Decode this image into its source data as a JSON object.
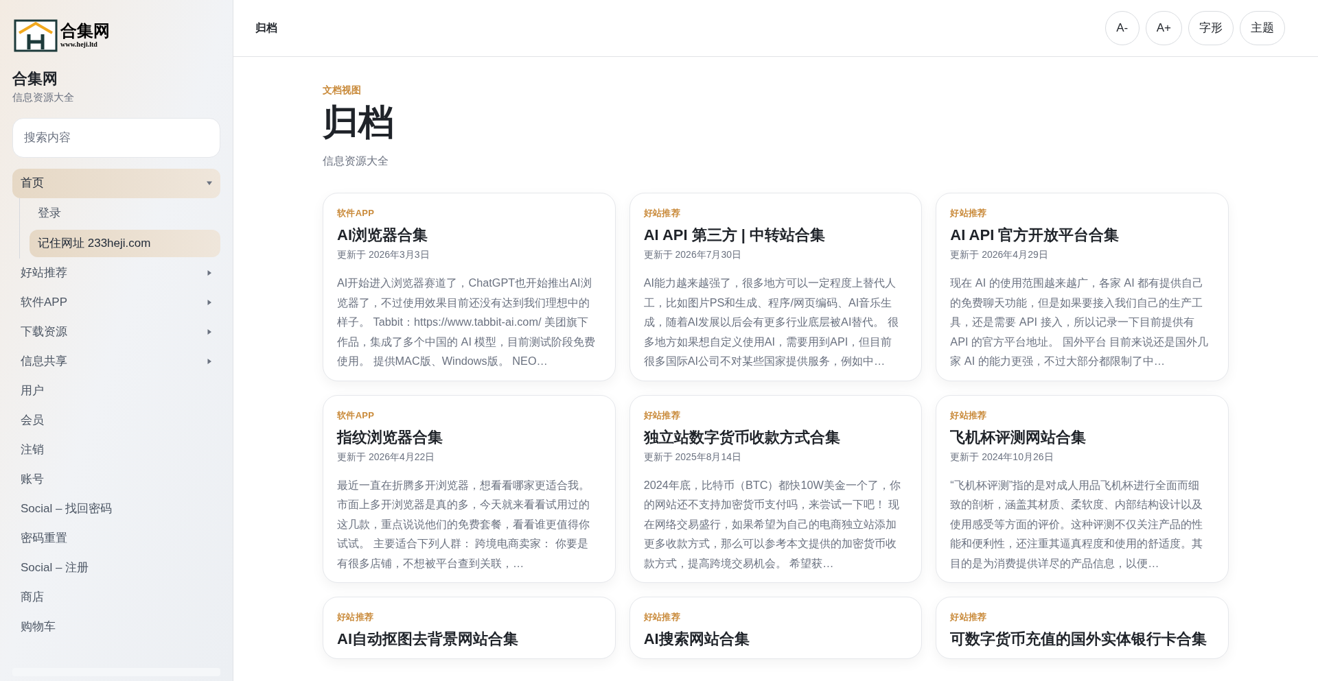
{
  "sidebar": {
    "logo": {
      "mark_text": "合集网",
      "url": "www.heji.ltd"
    },
    "site_name": "合集网",
    "tagline": "信息资源大全",
    "search": {
      "placeholder": "搜索内容"
    },
    "nav": [
      {
        "label": "首页",
        "selected": true,
        "expanded": true,
        "children": [
          {
            "label": "登录",
            "selected": false
          },
          {
            "label": "记住网址 233heji.com",
            "selected": true
          }
        ]
      },
      {
        "label": "好站推荐",
        "selected": false,
        "expanded": false
      },
      {
        "label": "软件APP",
        "selected": false,
        "expanded": false
      },
      {
        "label": "下载资源",
        "selected": false,
        "expanded": false
      },
      {
        "label": "信息共享",
        "selected": false,
        "expanded": false
      },
      {
        "label": "用户",
        "selected": false
      },
      {
        "label": "会员",
        "selected": false
      },
      {
        "label": "注销",
        "selected": false
      },
      {
        "label": "账号",
        "selected": false
      },
      {
        "label": "Social – 找回密码",
        "selected": false
      },
      {
        "label": "密码重置",
        "selected": false
      },
      {
        "label": "Social – 注册",
        "selected": false
      },
      {
        "label": "商店",
        "selected": false
      },
      {
        "label": "购物车",
        "selected": false
      }
    ]
  },
  "header": {
    "breadcrumb": "归档",
    "buttons": [
      "A-",
      "A+",
      "字形",
      "主题"
    ]
  },
  "page": {
    "eyebrow": "文档视图",
    "title": "归档",
    "subtitle": "信息资源大全"
  },
  "cards": [
    {
      "category": "软件APP",
      "title": "AI浏览器合集",
      "date": "更新于 2026年3月3日",
      "excerpt": "AI开始进入浏览器赛道了，ChatGPT也开始推出AI浏览器了，不过使用效果目前还没有达到我们理想中的样子。 Tabbit：https://www.tabbit-ai.com/ 美团旗下作品，集成了多个中国的 AI 模型，目前测试阶段免费使用。 提供MAC版、Windows版。 NEO…"
    },
    {
      "category": "好站推荐",
      "title": "AI API 第三方 | 中转站合集",
      "date": "更新于 2026年7月30日",
      "excerpt": "AI能力越来越强了，很多地方可以一定程度上替代人工，比如图片PS和生成、程序/网页编码、AI音乐生成，随着AI发展以后会有更多行业底层被AI替代。 很多地方如果想自定义使用AI，需要用到API，但目前很多国际AI公司不对某些国家提供服务，例如中…"
    },
    {
      "category": "好站推荐",
      "title": "AI API 官方开放平台合集",
      "date": "更新于 2026年4月29日",
      "excerpt": "现在 AI 的使用范围越来越广，各家 AI 都有提供自己的免费聊天功能，但是如果要接入我们自己的生产工具，还是需要 API 接入，所以记录一下目前提供有 API 的官方平台地址。 国外平台 目前来说还是国外几家 AI 的能力更强，不过大部分都限制了中…"
    },
    {
      "category": "软件APP",
      "title": "指纹浏览器合集",
      "date": "更新于 2026年4月22日",
      "excerpt": "最近一直在折腾多开浏览器，想看看哪家更适合我。市面上多开浏览器是真的多，今天就来看看试用过的这几款，重点说说他们的免费套餐，看看谁更值得你试试。 主要适合下列人群： 跨境电商卖家： 你要是有很多店铺，不想被平台查到关联，…"
    },
    {
      "category": "好站推荐",
      "title": "独立站数字货币收款方式合集",
      "date": "更新于 2025年8月14日",
      "excerpt": "2024年底，比特币（BTC）都快10W美金一个了，你的网站还不支持加密货币支付吗，来尝试一下吧！ 现在网络交易盛行，如果希望为自己的电商独立站添加更多收款方式，那么可以参考本文提供的加密货币收款方式，提高跨境交易机会。 希望获…"
    },
    {
      "category": "好站推荐",
      "title": "飞机杯评测网站合集",
      "date": "更新于 2024年10月26日",
      "excerpt": "“飞机杯评测”指的是对成人用品飞机杯进行全面而细致的剖析，涵盖其材质、柔软度、内部结构设计以及使用感受等方面的评价。这种评测不仅关注产品的性能和便利性，还注重其逼真程度和使用的舒适度。其目的是为消费提供详尽的产品信息，以便…"
    },
    {
      "category": "好站推荐",
      "title": "AI自动抠图去背景网站合集"
    },
    {
      "category": "好站推荐",
      "title": "AI搜索网站合集"
    },
    {
      "category": "好站推荐",
      "title": "可数字货币充值的国外实体银行卡合集"
    }
  ]
}
